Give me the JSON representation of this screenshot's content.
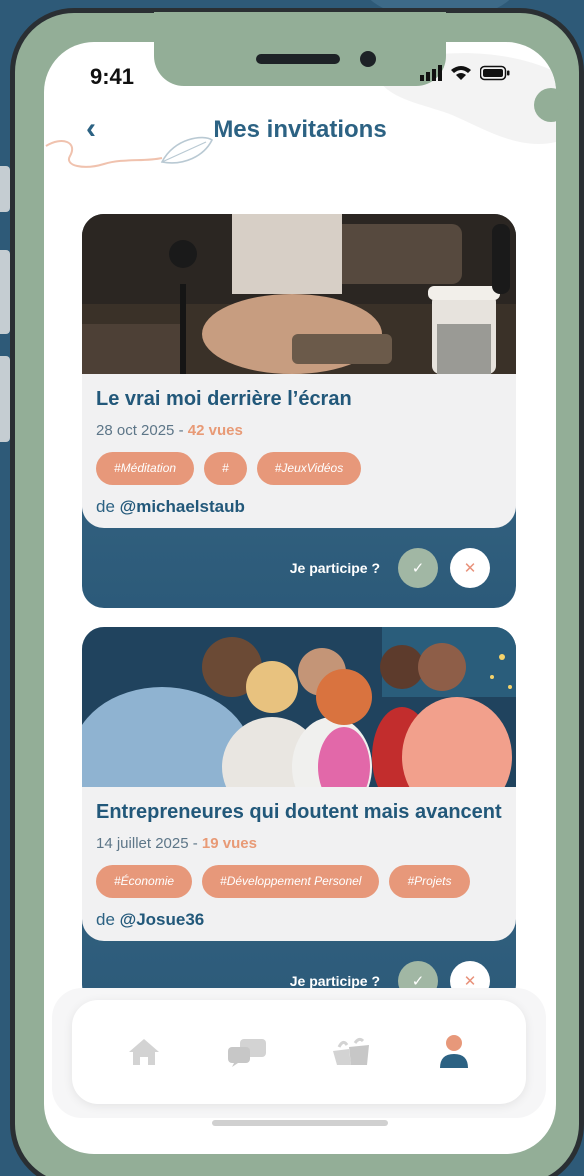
{
  "status_bar": {
    "time": "9:41"
  },
  "header": {
    "title": "Mes invitations",
    "back_icon": "chevron-left-icon"
  },
  "colors": {
    "background": "#2e5a78",
    "phone_frame": "#93ae97",
    "primary": "#2c6283",
    "accent": "#e7987a",
    "card": "#f1f1f2",
    "confirm": "#a1b7a4"
  },
  "invitations": [
    {
      "title": "Le vrai moi derrière l’écran",
      "date": "28 oct 2025",
      "separator": " - ",
      "views": "42 vues",
      "tags": [
        "#Méditation",
        "#",
        "#JeuxVidéos"
      ],
      "author_prefix": "de ",
      "author": "@michaelstaub",
      "participate_label": "Je participe ?",
      "accept_symbol": "✓",
      "decline_symbol": "✕"
    },
    {
      "title": "Entrepreneures qui doutent mais avancent",
      "date": "14 juillet 2025",
      "separator": " - ",
      "views": "19 vues",
      "tags": [
        "#Économie",
        "#Développement Personel",
        "#Projets"
      ],
      "author_prefix": "de ",
      "author": "@Josue36",
      "participate_label": "Je participe ?",
      "accept_symbol": "✓",
      "decline_symbol": "✕"
    }
  ],
  "tab_bar": {
    "items": [
      {
        "icon": "home-icon",
        "active": false
      },
      {
        "icon": "chat-bubbles-icon",
        "active": false
      },
      {
        "icon": "community-icon",
        "active": false
      },
      {
        "icon": "profile-icon",
        "active": true
      }
    ]
  }
}
